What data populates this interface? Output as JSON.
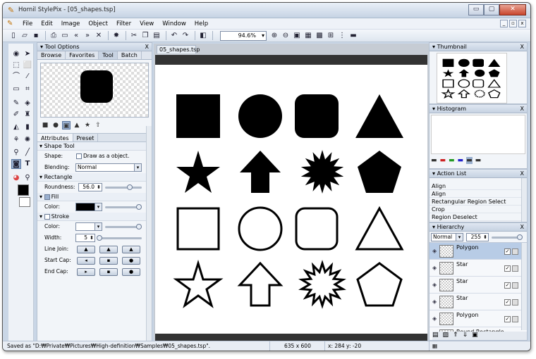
{
  "window": {
    "title": "Hornil StylePix - [05_shapes.tsp]",
    "buttons": {
      "minimize": "▭",
      "maximize": "▢",
      "close": "✕"
    }
  },
  "menu": {
    "items": [
      "File",
      "Edit",
      "Image",
      "Object",
      "Filter",
      "View",
      "Window",
      "Help"
    ],
    "mdi": [
      "_",
      "▫",
      "x"
    ]
  },
  "toolbar": {
    "zoom": "94.6%"
  },
  "tool_options": {
    "title": "Tool Options",
    "tabs": [
      "Browse",
      "Favorites",
      "Tool",
      "Batch"
    ],
    "active_tab": "Tool",
    "attr_tabs": [
      "Attributes",
      "Preset"
    ],
    "shape_tool": {
      "header": "Shape Tool",
      "shape_label": "Shape:",
      "draw_as_object": "Draw as a object.",
      "blending_label": "Blending:",
      "blending_value": "Normal"
    },
    "rectangle": {
      "header": "Rectangle",
      "roundness_label": "Roundness:",
      "roundness_value": "56.0",
      "roundness_pct": 0.7
    },
    "fill": {
      "header": "Fill",
      "color_label": "Color:",
      "color": "#000000"
    },
    "stroke": {
      "header": "Stroke",
      "color_label": "Color:",
      "width_label": "Width:",
      "width_value": "5",
      "line_join_label": "Line Join:",
      "start_cap_label": "Start Cap:",
      "end_cap_label": "End Cap:"
    }
  },
  "document": {
    "tab": "05_shapes.tsp",
    "shapes": [
      [
        "filled-square",
        "filled-circle",
        "filled-rounded-square",
        "filled-triangle"
      ],
      [
        "filled-star",
        "filled-arrow",
        "filled-burst",
        "filled-pentagon"
      ],
      [
        "outline-square",
        "outline-circle",
        "outline-rounded-square",
        "outline-triangle"
      ],
      [
        "outline-star",
        "outline-arrow",
        "outline-burst",
        "outline-pentagon"
      ]
    ]
  },
  "thumbnail": {
    "title": "Thumbnail"
  },
  "histogram": {
    "title": "Histogram"
  },
  "action_list": {
    "title": "Action List",
    "items": [
      "Align",
      "Align",
      "Rectangular Region Select",
      "Crop",
      "Region Deselect"
    ]
  },
  "hierarchy": {
    "title": "Hierarchy",
    "blend": "Normal",
    "opacity": "255",
    "items": [
      "Polygon",
      "Star",
      "Star",
      "Star",
      "Polygon",
      "Round Rectangle"
    ]
  },
  "status": {
    "saved": "Saved as \"D:₩Private₩Pictures₩High-definition₩Samples₩05_shapes.tsp\".",
    "size": "635 x 600 ARGB",
    "coords": "x: 284 y: -20"
  }
}
